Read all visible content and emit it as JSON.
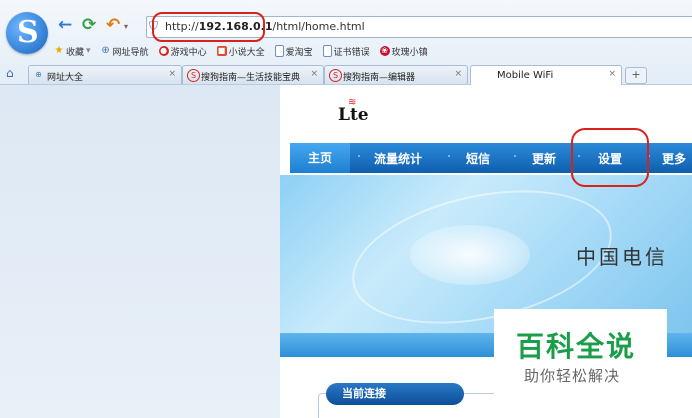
{
  "browser": {
    "logo_letter": "S",
    "back_glyph": "←",
    "refresh_glyph": "⟳",
    "undo_glyph": "↶",
    "shield_glyph": "⛉",
    "url_prefix": "http://",
    "url_host": "192.168.0.1",
    "url_path": "/html/home.html",
    "favorites": [
      {
        "label": "收藏",
        "icon": "star-icon"
      },
      {
        "label": "网址导航",
        "icon": "globe-icon"
      },
      {
        "label": "游戏中心",
        "icon": "game-icon"
      },
      {
        "label": "小说大全",
        "icon": "book-icon"
      },
      {
        "label": "爱淘宝",
        "icon": "page-icon"
      },
      {
        "label": "证书错误",
        "icon": "page-icon"
      },
      {
        "label": "玫瑰小镇",
        "icon": "rose-icon"
      }
    ],
    "tabs": [
      {
        "label": "网址大全",
        "close": "×"
      },
      {
        "label": "搜狗指南—生活技能宝典",
        "close": "×"
      },
      {
        "label": "搜狗指南—编辑器",
        "close": "×"
      },
      {
        "label": "Mobile WiFi",
        "close": "×"
      }
    ],
    "new_tab": "+"
  },
  "site": {
    "logo_text": "Lte",
    "menu": [
      "主页",
      "流量统计",
      "短信",
      "更新",
      "设置",
      "更多"
    ],
    "slogan": "中国电信",
    "status_title": "当前连接"
  },
  "watermark": {
    "main": "百科全说",
    "sub": "助你轻松解决"
  },
  "colors": {
    "accent": "#1565c0",
    "highlight_circle": "#d9221c",
    "menu_bar": "#0f5fae",
    "watermark_green": "#1a9e4a"
  }
}
